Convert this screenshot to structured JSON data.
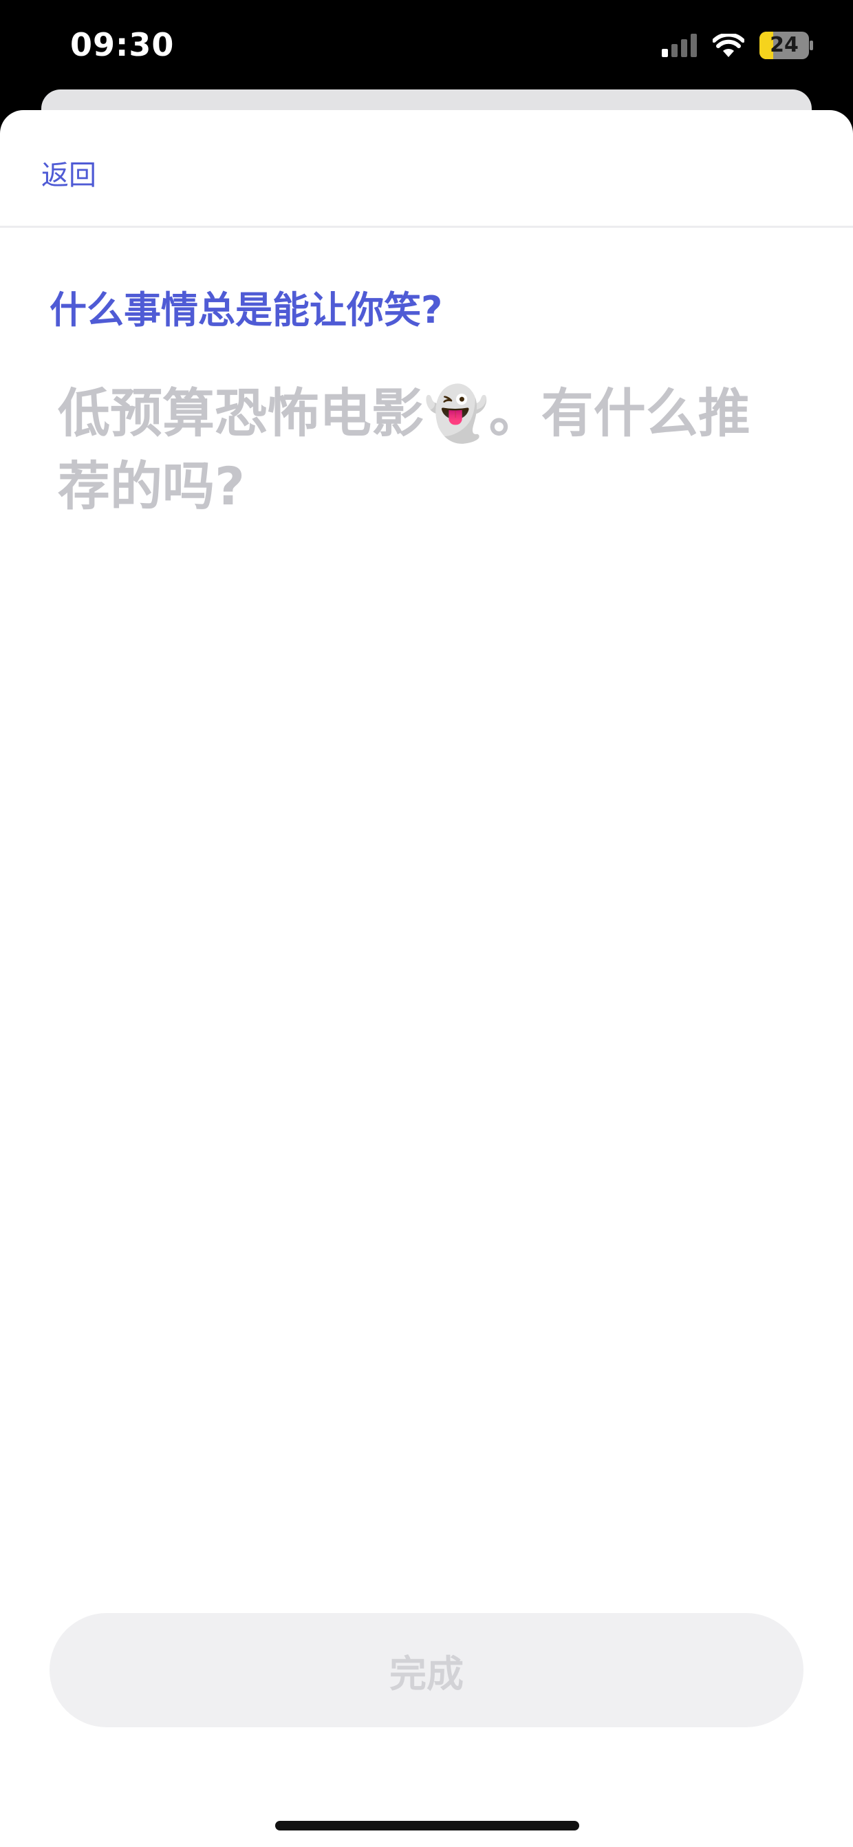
{
  "status_bar": {
    "time": "09:30",
    "battery_level": "24",
    "icons": [
      "signal-icon",
      "wifi-icon",
      "battery-icon"
    ]
  },
  "nav": {
    "back_label": "返回"
  },
  "question": {
    "title": "什么事情总是能让你笑?"
  },
  "answer": {
    "value": "",
    "placeholder": "低预算恐怖电影👻。有什么推荐的吗?"
  },
  "footer": {
    "done_label": "完成"
  },
  "colors": {
    "accent": "#4f5bd5",
    "placeholder": "#c5c5ca",
    "button_bg": "#f0f0f2",
    "button_text_disabled": "#d2d2d6"
  }
}
